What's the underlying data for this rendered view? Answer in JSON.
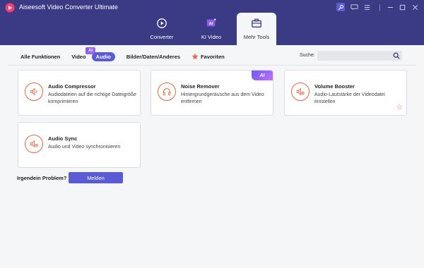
{
  "app": {
    "title": "Aiseesoft Video Converter Ultimate"
  },
  "main_tabs": [
    {
      "label": "Converter",
      "icon": "converter-icon"
    },
    {
      "label": "KI Video",
      "icon": "ai-video-icon"
    },
    {
      "label": "Mehr Tools",
      "icon": "toolbox-icon"
    }
  ],
  "subnav": {
    "items": [
      "Alle Funktionen",
      "Video",
      "Audio",
      "Bilder/Daten/Anderes",
      "Favoriten"
    ],
    "active": "Audio",
    "ai_mini": "AI"
  },
  "search": {
    "label": "Suche:",
    "value": "",
    "placeholder": ""
  },
  "cards": [
    {
      "title": "Audio Compressor",
      "desc": "Audiodateien auf die richtige Dateigröße komprimieren",
      "icon": "audio-compress-icon"
    },
    {
      "title": "Noise Remover",
      "desc": "Hintergrundgeräusche aus dem Video entfernen",
      "icon": "headphones-icon",
      "badge": "AI"
    },
    {
      "title": "Volume Booster",
      "desc": "Audio-Lautstärke der Videodatei einstellen",
      "icon": "volume-icon",
      "favorite": true
    },
    {
      "title": "Audio Sync",
      "desc": "Audio und Video synchronisieren",
      "icon": "audio-sync-icon"
    }
  ],
  "problem": {
    "label": "Irgendein Problem?",
    "button": "Melden"
  },
  "colors": {
    "header": "#3a3a85",
    "accent": "#5b5bd8",
    "icon_orange": "#f0643c"
  }
}
